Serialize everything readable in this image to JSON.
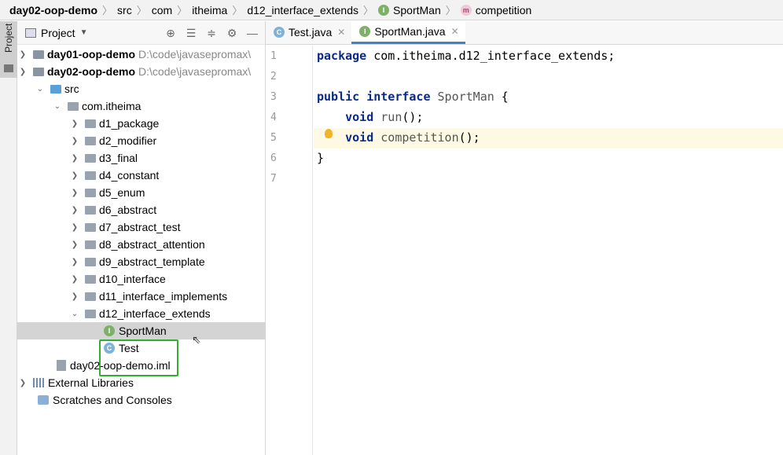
{
  "breadcrumb": {
    "items": [
      {
        "label": "day02-oop-demo",
        "bold": true
      },
      {
        "label": "src"
      },
      {
        "label": "com"
      },
      {
        "label": "itheima"
      },
      {
        "label": "d12_interface_extends"
      },
      {
        "label": "SportMan",
        "icon": "interface-icon"
      },
      {
        "label": "competition",
        "icon": "method-icon"
      }
    ]
  },
  "tool_window": {
    "label": "Project"
  },
  "project_panel": {
    "title": "Project",
    "tree": [
      {
        "label": "day01-oop-demo",
        "path": "D:\\code\\javasepromax\\",
        "bold": true,
        "expanded": false
      },
      {
        "label": "day02-oop-demo",
        "path": "D:\\code\\javasepromax\\",
        "bold": true,
        "expanded": true
      },
      {
        "label": "src"
      },
      {
        "label": "com.itheima"
      },
      {
        "label": "d1_package"
      },
      {
        "label": "d2_modifier"
      },
      {
        "label": "d3_final"
      },
      {
        "label": "d4_constant"
      },
      {
        "label": "d5_enum"
      },
      {
        "label": "d6_abstract"
      },
      {
        "label": "d7_abstract_test"
      },
      {
        "label": "d8_abstract_attention"
      },
      {
        "label": "d9_abstract_template"
      },
      {
        "label": "d10_interface"
      },
      {
        "label": "d11_interface_implements"
      },
      {
        "label": "d12_interface_extends"
      },
      {
        "label": "SportMan",
        "icon": "interface-icon",
        "selected": true
      },
      {
        "label": "Test",
        "icon": "class-icon"
      },
      {
        "label": "day02-oop-demo.iml"
      },
      {
        "label": "External Libraries"
      },
      {
        "label": "Scratches and Consoles"
      }
    ]
  },
  "editor": {
    "tabs": [
      {
        "label": "Test.java",
        "icon": "class-icon",
        "active": false
      },
      {
        "label": "SportMan.java",
        "icon": "interface-icon",
        "active": true
      }
    ],
    "line_numbers": [
      "1",
      "2",
      "3",
      "4",
      "5",
      "6",
      "7"
    ],
    "code_lines": [
      "package com.itheima.d12_interface_extends;",
      "",
      "public interface SportMan {",
      "    void run();",
      "    void competition();",
      "}",
      ""
    ],
    "current_line": 5
  },
  "colors": {
    "accent": "#4083c9",
    "highlight_box": "#2fb12f",
    "current_line_bg": "#fdf9e3"
  }
}
